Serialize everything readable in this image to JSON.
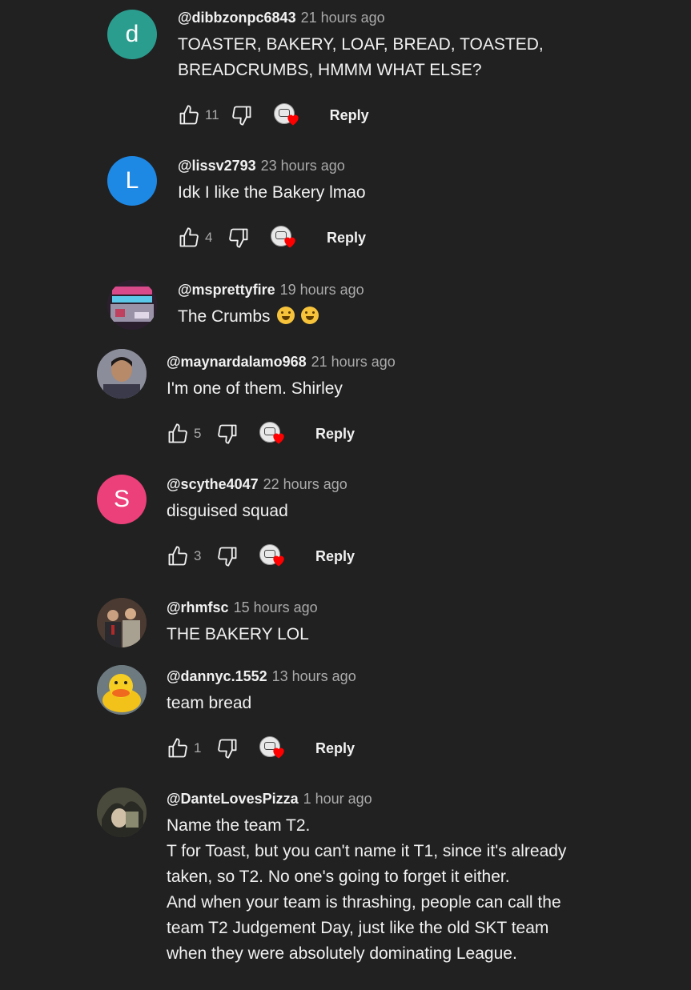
{
  "ui": {
    "reply_label": "Reply"
  },
  "colors": {
    "background": "#212121",
    "text": "#f1f1f1",
    "muted": "#aaaaaa",
    "heart": "#ff0000"
  },
  "comments": [
    {
      "handle": "@dibbzonpc6843",
      "time": "21 hours ago",
      "avatar_letter": "d",
      "avatar_color": "#2a9d8f",
      "lines": [
        "TOASTER, BAKERY, LOAF, BREAD, TOASTED,",
        "BREADCRUMBS, HMMM WHAT ELSE?"
      ],
      "likes": "11",
      "has_actions": true
    },
    {
      "handle": "@lissv2793",
      "time": "23 hours ago",
      "avatar_letter": "L",
      "avatar_color": "#1e88e5",
      "lines": [
        "Idk I like the Bakery lmao"
      ],
      "likes": "4",
      "has_actions": true
    },
    {
      "handle": "@msprettyfire",
      "time": "19 hours ago",
      "avatar_letter": "",
      "avatar_icon": "image-avatar-icon",
      "lines": [
        "The Crumbs"
      ],
      "has_actions": false
    },
    {
      "handle": "@maynardalamo968",
      "time": "21 hours ago",
      "avatar_letter": "",
      "avatar_icon": "photo-avatar-icon",
      "lines": [
        "I'm one of them. Shirley"
      ],
      "likes": "5",
      "has_actions": true
    },
    {
      "handle": "@scythe4047",
      "time": "22 hours ago",
      "avatar_letter": "S",
      "avatar_color": "#ec407a",
      "lines": [
        "disguised squad"
      ],
      "likes": "3",
      "has_actions": true
    },
    {
      "handle": "@rhmfsc",
      "time": "15 hours ago",
      "avatar_letter": "",
      "avatar_icon": "photo-avatar-icon",
      "lines": [
        "THE BAKERY LOL"
      ],
      "has_actions": false
    },
    {
      "handle": "@dannyc.1552",
      "time": "13 hours ago",
      "avatar_letter": "",
      "avatar_icon": "duck-avatar-icon",
      "lines": [
        "team bread"
      ],
      "likes": "1",
      "has_actions": true
    },
    {
      "handle": "@DanteLovesPizza",
      "time": "1 hour ago",
      "avatar_letter": "",
      "avatar_icon": "photo-avatar-icon",
      "lines": [
        "Name the team T2.",
        "T for Toast, but you can't name it T1, since it's already",
        "taken, so T2. No one's going to forget it either.",
        "And when your team is thrashing, people can call the",
        "team T2 Judgement Day, just like the old SKT team",
        "when they were absolutely dominating League."
      ],
      "has_actions": false
    }
  ]
}
